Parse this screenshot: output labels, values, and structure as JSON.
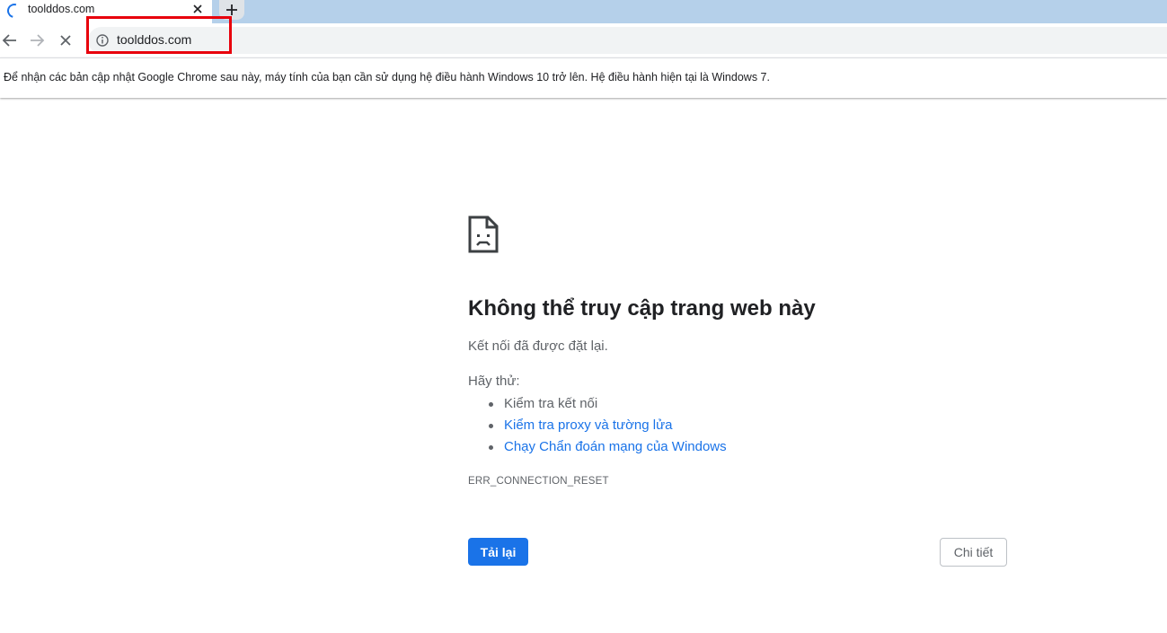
{
  "tab": {
    "title": "toolddos.com",
    "loading": true
  },
  "toolbar": {
    "url": "toolddos.com"
  },
  "infobar": {
    "message": "Để nhận các bản cập nhật Google Chrome sau này, máy tính của bạn cần sử dụng hệ điều hành Windows 10 trở lên. Hệ điều hành hiện tại là Windows 7."
  },
  "error_page": {
    "icon": "sad-document-icon",
    "title": "Không thể truy cập trang web này",
    "description": "Kết nối đã được đặt lại.",
    "try_label": "Hãy thử:",
    "suggestions": [
      {
        "label": "Kiểm tra kết nối",
        "link": false
      },
      {
        "label": "Kiểm tra proxy và tường lửa",
        "link": true
      },
      {
        "label": "Chạy Chẩn đoán mạng của Windows",
        "link": true
      }
    ],
    "error_code": "ERR_CONNECTION_RESET",
    "reload_label": "Tải lại",
    "details_label": "Chi tiết"
  },
  "colors": {
    "tabstrip": "#b5d0ea",
    "accent": "#1a73e8",
    "highlight": "#e8000c"
  }
}
